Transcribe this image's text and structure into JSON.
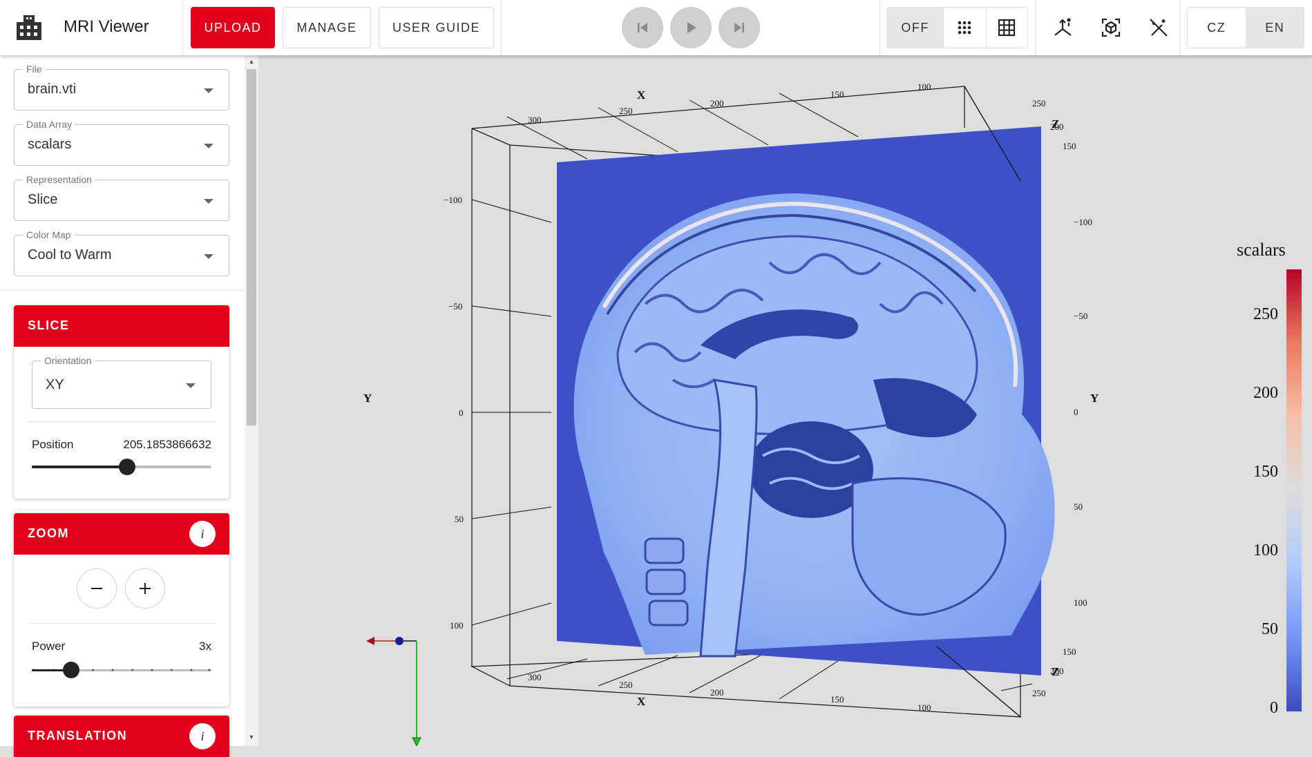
{
  "header": {
    "app_title": "MRI Viewer",
    "buttons": {
      "upload": "UPLOAD",
      "manage": "MANAGE",
      "user_guide": "USER GUIDE"
    },
    "grid_toggle": {
      "off": "OFF",
      "selected": "OFF"
    },
    "language": {
      "cz": "CZ",
      "en": "EN",
      "selected": "EN"
    }
  },
  "sidebar": {
    "file": {
      "label": "File",
      "value": "brain.vti"
    },
    "data_array": {
      "label": "Data Array",
      "value": "scalars"
    },
    "representation": {
      "label": "Representation",
      "value": "Slice"
    },
    "color_map": {
      "label": "Color Map",
      "value": "Cool to Warm"
    },
    "slice": {
      "title": "SLICE",
      "orientation": {
        "label": "Orientation",
        "value": "XY"
      },
      "position": {
        "label": "Position",
        "value": "205.1853866632",
        "fraction": 0.53
      }
    },
    "zoom": {
      "title": "ZOOM",
      "info": "i",
      "power": {
        "label": "Power",
        "value": "3x",
        "fraction": 0.22
      }
    },
    "translation": {
      "title": "TRANSLATION",
      "info": "i"
    }
  },
  "viewport": {
    "axis_titles": {
      "x": "X",
      "y": "Y",
      "z": "Z"
    },
    "x_ticks": [
      "300",
      "250",
      "200",
      "150",
      "100"
    ],
    "y_ticks_left": [
      "−100",
      "−50",
      "0",
      "50",
      "100"
    ],
    "y_ticks_right": [
      "−100",
      "−50",
      "0",
      "50",
      "100"
    ],
    "z_ticks": [
      "250",
      "200",
      "150"
    ],
    "colorbar": {
      "title": "scalars",
      "ticks": [
        "250",
        "200",
        "150",
        "100",
        "50",
        "0"
      ],
      "colors": [
        "#3b4cc0",
        "#7396f5",
        "#b0cbfc",
        "#dddddd",
        "#f6bfa6",
        "#ea7b60",
        "#b40426"
      ]
    }
  }
}
